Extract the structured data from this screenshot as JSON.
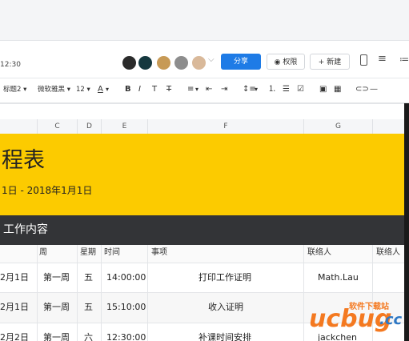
{
  "header": {
    "time": "12:30",
    "share_label": "分享",
    "permission_label": "权限",
    "new_label": "+ 新建"
  },
  "toolbar": {
    "heading_label": "标题2",
    "font_label": "微软雅黑",
    "size_label": "12"
  },
  "sheet": {
    "columns": [
      "C",
      "D",
      "E",
      "F",
      "G"
    ],
    "title": "程表",
    "date_range": "1日 - 2018年1月1日",
    "section_title": "工作内容",
    "headers": [
      "周",
      "星期",
      "时间",
      "事项",
      "联络人",
      "联络人"
    ],
    "rows": [
      {
        "date": "2月1日",
        "week": "第一周",
        "day": "五",
        "time": "14:00:00",
        "item": "打印工作证明",
        "contact": "Math.Lau"
      },
      {
        "date": "2月1日",
        "week": "第一周",
        "day": "五",
        "time": "15:10:00",
        "item": "收入证明",
        "contact": ""
      },
      {
        "date": "2月2日",
        "week": "第一周",
        "day": "六",
        "time": "12:30:00",
        "item": "补课时间安排",
        "contact": "jackchen"
      }
    ]
  },
  "watermark": {
    "top_text": "软件下载站",
    "brand": "ucbug",
    "tld": ".cc"
  },
  "colors": {
    "accent_blue": "#1e7be6",
    "banner_yellow": "#fccb00",
    "section_dark": "#333437",
    "watermark_orange": "#f47920",
    "watermark_blue": "#2f78c4"
  }
}
